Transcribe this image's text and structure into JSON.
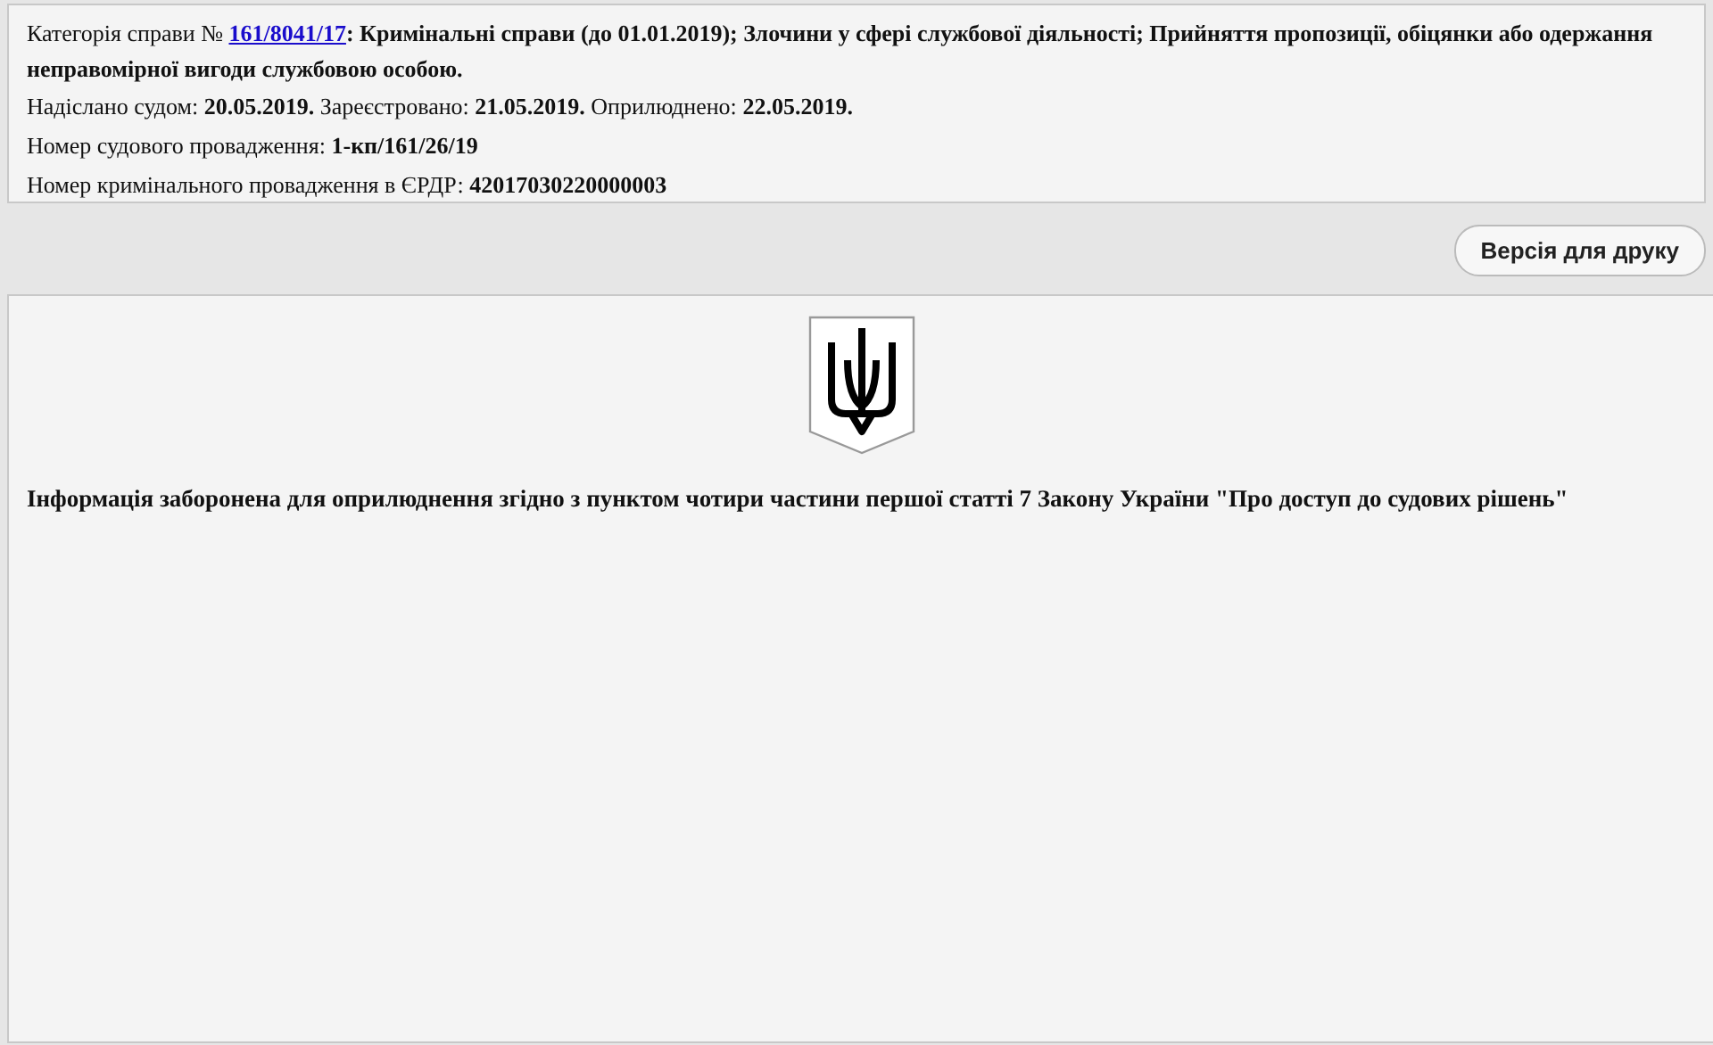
{
  "case_info": {
    "category_label": "Категорія справи № ",
    "case_number": "161/8041/17",
    "category_text": ": Кримінальні справи (до 01.01.2019); Злочини у сфері службової діяльності; Прийняття пропозиції, обіцянки або одержання неправомірної вигоди службовою особою.",
    "lines": [
      "Надіслано судом: **20.05.2019.** Зареєстровано: **21.05.2019.** Оприлюднено: **22.05.2019.**",
      "Номер судового провадження: **1-кп/161/26/19**",
      "Номер кримінального провадження в ЄРДР: **42017030220000003**"
    ]
  },
  "print_button": "Версія для друку",
  "document": {
    "notice": "Інформація заборонена для оприлюднення згідно з пунктом чотири частини першої статті 7 Закону України \"Про доступ до судових рішень\""
  }
}
